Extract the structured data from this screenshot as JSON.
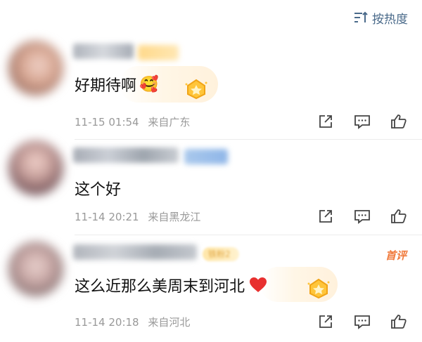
{
  "sort": {
    "label": "按热度",
    "icon": "sort-icon"
  },
  "comments": [
    {
      "text": "好期待啊",
      "emoji": "smiling-face-with-flowers-emoji",
      "time": "11-15 01:54",
      "location": "来自广东",
      "badge_icon": "gold-medal-icon"
    },
    {
      "text": "这个好",
      "time": "11-14 20:21",
      "location": "来自黑龙江"
    },
    {
      "text": "这么近那么美周末到河北",
      "emoji": "red-heart-emoji",
      "time": "11-14 20:18",
      "location": "来自河北",
      "fan_badge": "铁粉2",
      "tag": "首评",
      "badge_icon": "gold-medal-icon"
    }
  ],
  "actions": [
    "share-icon",
    "comment-icon",
    "like-icon"
  ],
  "colors": {
    "accent": "#4a6a8a",
    "meta": "#999999",
    "tag": "#f07a3c",
    "heart": "#e8302f"
  }
}
